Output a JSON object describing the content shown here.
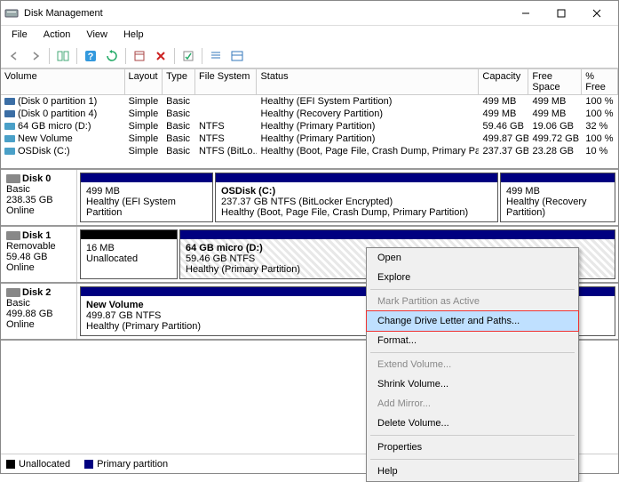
{
  "title": "Disk Management",
  "menu": {
    "file": "File",
    "action": "Action",
    "view": "View",
    "help": "Help"
  },
  "columns": {
    "volume": "Volume",
    "layout": "Layout",
    "type": "Type",
    "fs": "File System",
    "status": "Status",
    "capacity": "Capacity",
    "free": "Free Space",
    "pct": "% Free"
  },
  "volumes": [
    {
      "name": "(Disk 0 partition 1)",
      "layout": "Simple",
      "type": "Basic",
      "fs": "",
      "status": "Healthy (EFI System Partition)",
      "capacity": "499 MB",
      "free": "499 MB",
      "pct": "100 %",
      "color": "#3b6ea5"
    },
    {
      "name": "(Disk 0 partition 4)",
      "layout": "Simple",
      "type": "Basic",
      "fs": "",
      "status": "Healthy (Recovery Partition)",
      "capacity": "499 MB",
      "free": "499 MB",
      "pct": "100 %",
      "color": "#3b6ea5"
    },
    {
      "name": "64 GB micro (D:)",
      "layout": "Simple",
      "type": "Basic",
      "fs": "NTFS",
      "status": "Healthy (Primary Partition)",
      "capacity": "59.46 GB",
      "free": "19.06 GB",
      "pct": "32 %",
      "color": "#4aa0c8"
    },
    {
      "name": "New Volume",
      "layout": "Simple",
      "type": "Basic",
      "fs": "NTFS",
      "status": "Healthy (Primary Partition)",
      "capacity": "499.87 GB",
      "free": "499.72 GB",
      "pct": "100 %",
      "color": "#4aa0c8"
    },
    {
      "name": "OSDisk (C:)",
      "layout": "Simple",
      "type": "Basic",
      "fs": "NTFS (BitLo...",
      "status": "Healthy (Boot, Page File, Crash Dump, Primary Partition)",
      "capacity": "237.37 GB",
      "free": "23.28 GB",
      "pct": "10 %",
      "color": "#4aa0c8"
    }
  ],
  "disks": {
    "d0": {
      "name": "Disk 0",
      "type": "Basic",
      "size": "238.35 GB",
      "state": "Online"
    },
    "d1": {
      "name": "Disk 1",
      "type": "Removable",
      "size": "59.48 GB",
      "state": "Online"
    },
    "d2": {
      "name": "Disk 2",
      "type": "Basic",
      "size": "499.88 GB",
      "state": "Online"
    }
  },
  "parts": {
    "d0p1": {
      "title": "",
      "line1": "499 MB",
      "line2": "Healthy (EFI System Partition"
    },
    "d0p2": {
      "title": "OSDisk  (C:)",
      "line1": "237.37 GB NTFS (BitLocker Encrypted)",
      "line2": "Healthy (Boot, Page File, Crash Dump, Primary Partition)"
    },
    "d0p3": {
      "title": "",
      "line1": "499 MB",
      "line2": "Healthy (Recovery Partition)"
    },
    "d1p0": {
      "title": "",
      "line1": "16 MB",
      "line2": "Unallocated"
    },
    "d1p1": {
      "title": "64 GB micro  (D:)",
      "line1": "59.46 GB NTFS",
      "line2": "Healthy (Primary Partition)"
    },
    "d2p1": {
      "title": "New Volume",
      "line1": "499.87 GB NTFS",
      "line2": "Healthy (Primary Partition)"
    }
  },
  "legend": {
    "unalloc": "Unallocated",
    "primary": "Primary partition"
  },
  "context": {
    "open": "Open",
    "explore": "Explore",
    "mark": "Mark Partition as Active",
    "change": "Change Drive Letter and Paths...",
    "format": "Format...",
    "extend": "Extend Volume...",
    "shrink": "Shrink Volume...",
    "mirror": "Add Mirror...",
    "delete": "Delete Volume...",
    "properties": "Properties",
    "help": "Help"
  }
}
